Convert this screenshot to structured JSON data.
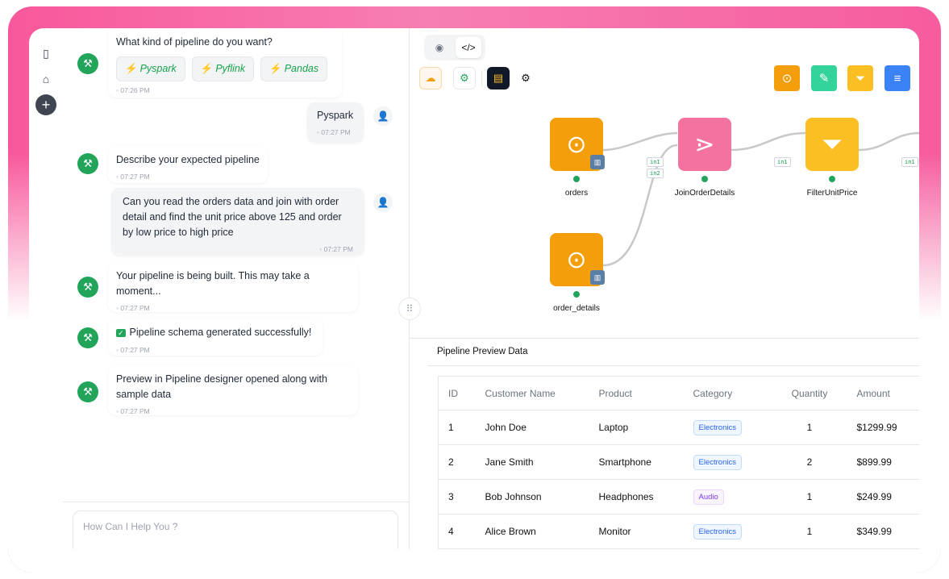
{
  "chat": {
    "messages": [
      {
        "text": "What kind of pipeline do you want?",
        "time": "07:26 PM"
      },
      {
        "text": "Pyspark",
        "time": "07:27 PM"
      },
      {
        "text": "Describe your expected pipeline",
        "time": "07:27 PM"
      },
      {
        "text": "Can you read the orders data and join with order detail and find the unit price above 125 and order by low price to high price",
        "time": "07:27 PM"
      },
      {
        "text": "Your pipeline is being built. This may take a moment...",
        "time": "07:27 PM"
      },
      {
        "text": "Pipeline schema generated successfully!",
        "time": "07:27 PM"
      },
      {
        "text": "Preview in Pipeline designer opened along with sample data",
        "time": "07:27 PM"
      }
    ],
    "options": [
      "Pyspark",
      "Pyflink",
      "Pandas"
    ],
    "input_placeholder": "How Can I Help You ?"
  },
  "designer": {
    "nodes": [
      {
        "label": "orders"
      },
      {
        "label": "JoinOrderDetails"
      },
      {
        "label": "FilterUnitPrice"
      },
      {
        "label": "order_details"
      }
    ],
    "tags": {
      "in1": "in1",
      "in2": "in2"
    },
    "preview_title": "Pipeline Preview Data",
    "table": {
      "headers": [
        "ID",
        "Customer Name",
        "Product",
        "Category",
        "Quantity",
        "Amount"
      ],
      "rows": [
        [
          "1",
          "John Doe",
          "Laptop",
          "Electronics",
          "1",
          "$1299.99"
        ],
        [
          "2",
          "Jane Smith",
          "Smartphone",
          "Electronics",
          "2",
          "$899.99"
        ],
        [
          "3",
          "Bob Johnson",
          "Headphones",
          "Audio",
          "1",
          "$249.99"
        ],
        [
          "4",
          "Alice Brown",
          "Monitor",
          "Electronics",
          "1",
          "$349.99"
        ]
      ]
    }
  },
  "colors": {
    "source": "#f59e0b",
    "join": "#f472a0",
    "filter": "#fbbf24",
    "bot": "#22a55b",
    "accent": "#f8589b"
  }
}
